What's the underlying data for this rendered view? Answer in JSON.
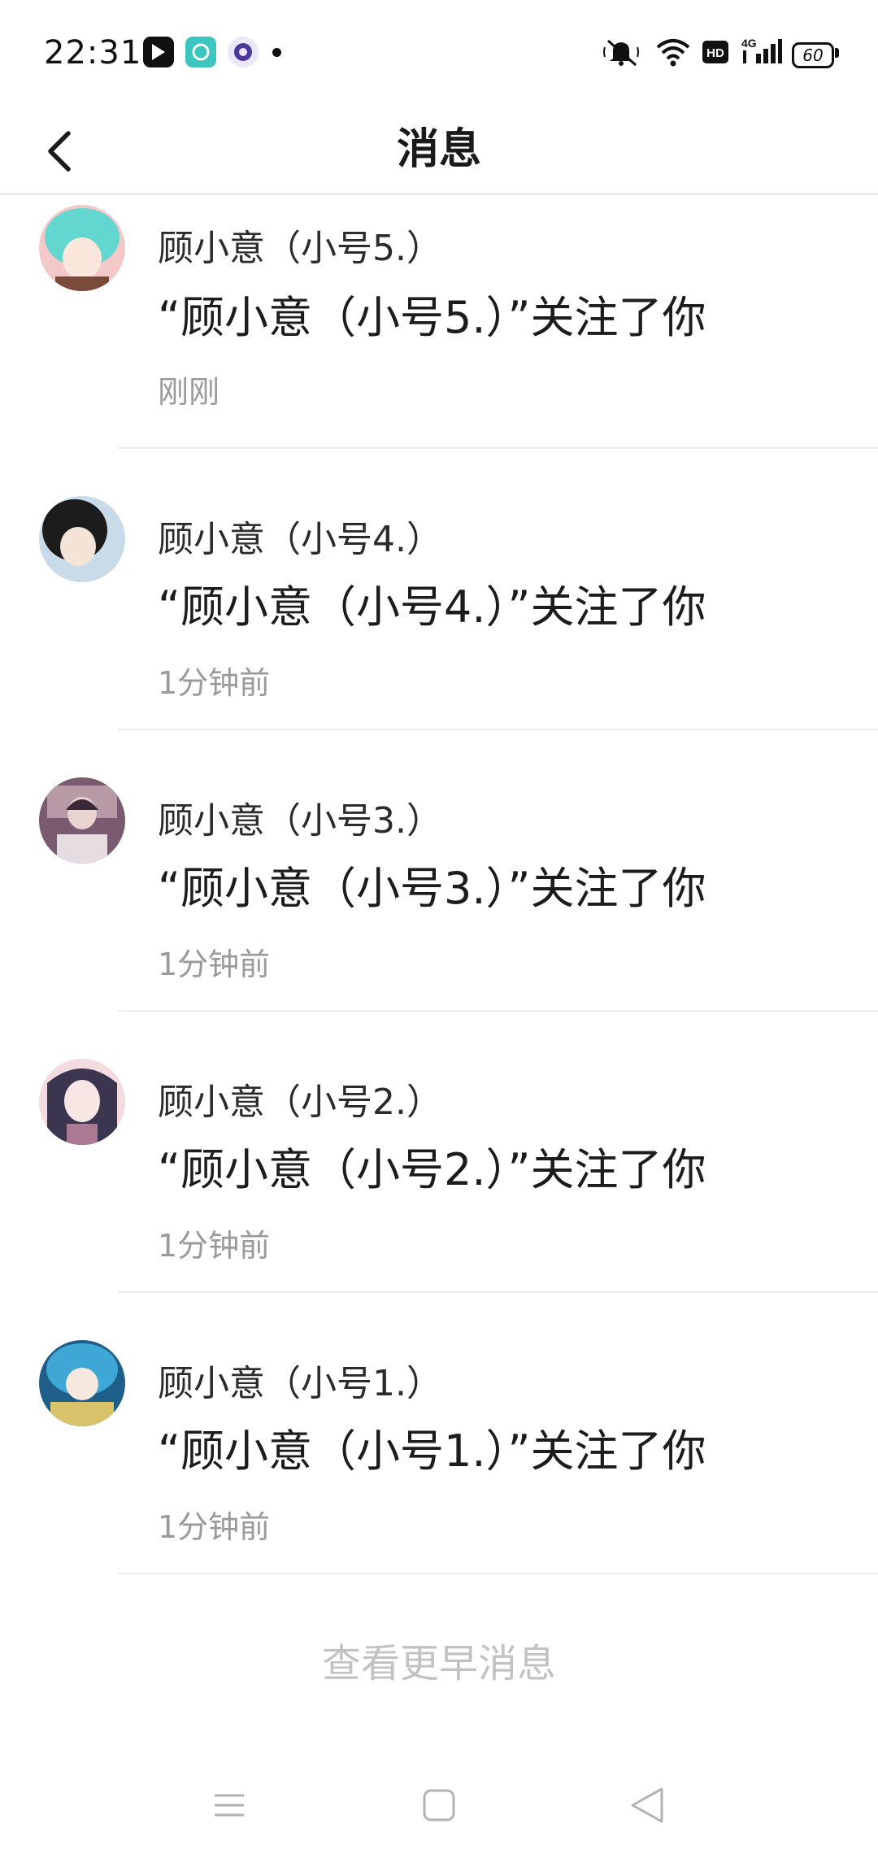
{
  "status_bar": {
    "time": "22:31",
    "battery": "60",
    "network": "4G",
    "hd_label": "HD"
  },
  "header": {
    "title": "消息"
  },
  "messages": [
    {
      "sender": "顾小意（小号5.）",
      "text": "“顾小意（小号5.）”关注了你",
      "time": "刚刚",
      "avatar_colors": [
        "#62d6cf",
        "#f3c8c8",
        "#7a4a3a"
      ]
    },
    {
      "sender": "顾小意（小号4.）",
      "text": "“顾小意（小号4.）”关注了你",
      "time": "1分钟前",
      "avatar_colors": [
        "#1c1c1c",
        "#c9dbe8",
        "#f4e4d8"
      ]
    },
    {
      "sender": "顾小意（小号3.）",
      "text": "“顾小意（小号3.）”关注了你",
      "time": "1分钟前",
      "avatar_colors": [
        "#7a5a6e",
        "#b89aa6",
        "#3a2a38"
      ]
    },
    {
      "sender": "顾小意（小号2.）",
      "text": "“顾小意（小号2.）”关注了你",
      "time": "1分钟前",
      "avatar_colors": [
        "#3b3550",
        "#f3dbe0",
        "#a97a92"
      ]
    },
    {
      "sender": "顾小意（小号1.）",
      "text": "“顾小意（小号1.）”关注了你",
      "time": "1分钟前",
      "avatar_colors": [
        "#3fa7d6",
        "#d9c36a",
        "#1e5f8a"
      ]
    }
  ],
  "footer": {
    "view_earlier": "查看更早消息"
  }
}
